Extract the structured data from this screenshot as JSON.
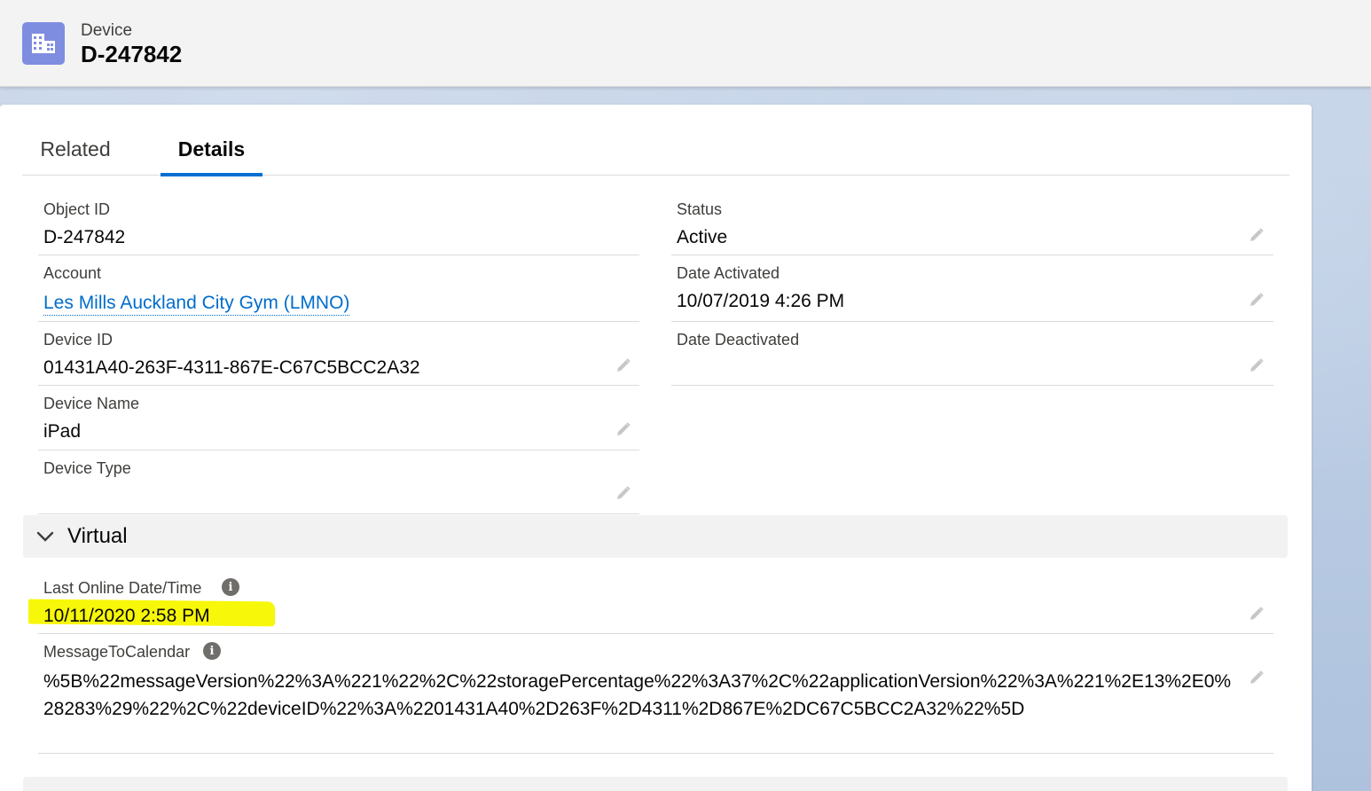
{
  "header": {
    "object_type": "Device",
    "record_title": "D-247842",
    "icon": "building-icon"
  },
  "tabs": [
    {
      "label": "Related",
      "active": false
    },
    {
      "label": "Details",
      "active": true
    }
  ],
  "fields": {
    "object_id": {
      "label": "Object ID",
      "value": "D-247842"
    },
    "account": {
      "label": "Account",
      "value": "Les Mills Auckland City Gym (LMNO)"
    },
    "device_id": {
      "label": "Device ID",
      "value": "01431A40-263F-4311-867E-C67C5BCC2A32"
    },
    "device_name": {
      "label": "Device Name",
      "value": "iPad"
    },
    "device_type": {
      "label": "Device Type",
      "value": ""
    },
    "status": {
      "label": "Status",
      "value": "Active"
    },
    "date_activated": {
      "label": "Date Activated",
      "value": "10/07/2019 4:26 PM"
    },
    "date_deactivated": {
      "label": "Date Deactivated",
      "value": ""
    }
  },
  "virtual_section": {
    "title": "Virtual",
    "expanded": true,
    "last_online": {
      "label": "Last Online Date/Time",
      "value": "10/11/2020 2:58 PM"
    },
    "message_to_calendar": {
      "label": "MessageToCalendar",
      "value": "%5B%22messageVersion%22%3A%221%22%2C%22storagePercentage%22%3A37%2C%22applicationVersion%22%3A%221%2E13%2E0%28283%29%22%2C%22deviceID%22%3A%2201431A40%2D263F%2D4311%2D867E%2DC67C5BCC2A32%22%5D"
    }
  },
  "colors": {
    "accent": "#0070d2",
    "link": "#006dcc",
    "icon_bg": "#7f8de1",
    "highlight": "#f7f70a"
  }
}
